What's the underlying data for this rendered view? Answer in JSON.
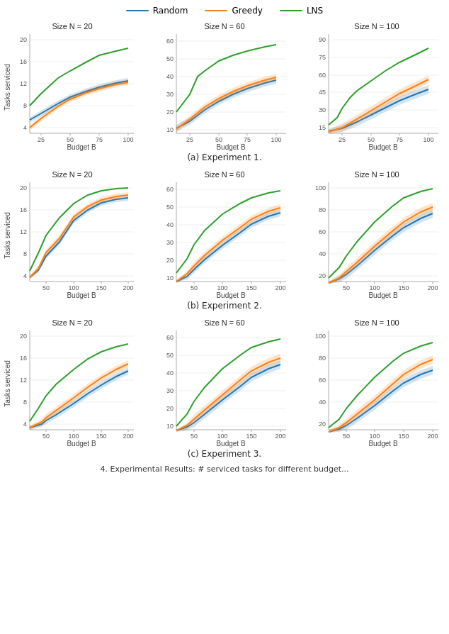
{
  "legend": {
    "items": [
      {
        "label": "Random",
        "color": "#1f77b4"
      },
      {
        "label": "Greedy",
        "color": "#ff7f0e"
      },
      {
        "label": "LNS",
        "color": "#2ca02c"
      }
    ]
  },
  "rows": [
    {
      "caption": "(a) Experiment 1.",
      "charts": [
        {
          "title": "Size N = 20",
          "xLabel": "Budget B",
          "yLabel": "Tasks serviced",
          "xTicks": [
            "25",
            "50",
            "75",
            "100"
          ],
          "yTicks": [
            "4",
            "8",
            "12",
            "16",
            "20"
          ],
          "xMin": 15,
          "xMax": 105,
          "yMin": 3,
          "yMax": 21
        },
        {
          "title": "Size N = 60",
          "xLabel": "Budget B",
          "yLabel": "",
          "xTicks": [
            "25",
            "50",
            "75",
            "100"
          ],
          "yTicks": [
            "10",
            "20",
            "30",
            "40",
            "50",
            "60"
          ],
          "xMin": 15,
          "xMax": 105,
          "yMin": 8,
          "yMax": 64
        },
        {
          "title": "Size N = 100",
          "xLabel": "Budget B",
          "yLabel": "",
          "xTicks": [
            "25",
            "50",
            "75",
            "100"
          ],
          "yTicks": [
            "15",
            "30",
            "45",
            "60",
            "75",
            "90"
          ],
          "xMin": 15,
          "xMax": 105,
          "yMin": 10,
          "yMax": 95
        }
      ]
    },
    {
      "caption": "(b) Experiment 2.",
      "charts": [
        {
          "title": "Size N = 20",
          "xLabel": "Budget B",
          "yLabel": "Tasks serviced",
          "xTicks": [
            "50",
            "100",
            "150",
            "200"
          ],
          "yTicks": [
            "4",
            "8",
            "12",
            "16",
            "20"
          ],
          "xMin": 20,
          "xMax": 210,
          "yMin": 3,
          "yMax": 21
        },
        {
          "title": "Size N = 60",
          "xLabel": "Budget B",
          "yLabel": "",
          "xTicks": [
            "50",
            "100",
            "150",
            "200"
          ],
          "yTicks": [
            "10",
            "20",
            "30",
            "40",
            "50",
            "60"
          ],
          "xMin": 20,
          "xMax": 210,
          "yMin": 8,
          "yMax": 64
        },
        {
          "title": "Size N = 100",
          "xLabel": "Budget B",
          "yLabel": "",
          "xTicks": [
            "50",
            "100",
            "150",
            "200"
          ],
          "yTicks": [
            "20",
            "40",
            "60",
            "80",
            "100"
          ],
          "xMin": 20,
          "xMax": 210,
          "yMin": 15,
          "yMax": 105
        }
      ]
    },
    {
      "caption": "(c) Experiment 3.",
      "charts": [
        {
          "title": "Size N = 20",
          "xLabel": "Budget B",
          "yLabel": "Tasks serviced",
          "xTicks": [
            "50",
            "100",
            "150",
            "200"
          ],
          "yTicks": [
            "4",
            "8",
            "12",
            "16",
            "20"
          ],
          "xMin": 20,
          "xMax": 210,
          "yMin": 3,
          "yMax": 21
        },
        {
          "title": "Size N = 60",
          "xLabel": "Budget B",
          "yLabel": "",
          "xTicks": [
            "50",
            "100",
            "150",
            "200"
          ],
          "yTicks": [
            "10",
            "20",
            "30",
            "40",
            "50",
            "60"
          ],
          "xMin": 20,
          "xMax": 210,
          "yMin": 8,
          "yMax": 64
        },
        {
          "title": "Size N = 100",
          "xLabel": "Budget B",
          "yLabel": "",
          "xTicks": [
            "50",
            "100",
            "150",
            "200"
          ],
          "yTicks": [
            "20",
            "40",
            "60",
            "80",
            "100"
          ],
          "xMin": 20,
          "xMax": 210,
          "yMin": 15,
          "yMax": 105
        }
      ]
    }
  ],
  "pageCaption": "4. Experimental Results: # serviced tasks for different budget..."
}
